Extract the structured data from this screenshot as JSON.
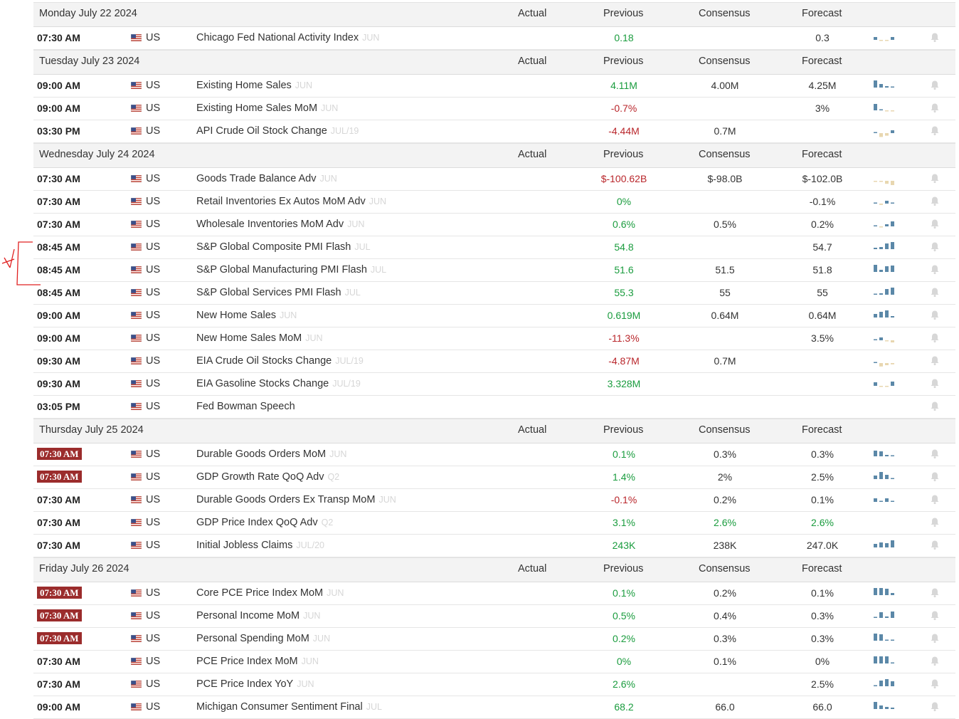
{
  "colors": {
    "positive": "#1a9c3e",
    "negative": "#b9262b",
    "neutral": "#333333",
    "time_badge": "#9b2c2c",
    "spark_blue": "#5b88a8",
    "spark_tan": "#e8d7b0"
  },
  "icons": {
    "flag": "us-flag-icon",
    "alert": "bell-icon",
    "trend": "sparkline-chart"
  },
  "columns": {
    "actual": "Actual",
    "previous": "Previous",
    "consensus": "Consensus",
    "forecast": "Forecast"
  },
  "days": [
    {
      "date": "Monday July 22 2024",
      "events": [
        {
          "time": "07:30 AM",
          "highlight": false,
          "country": "US",
          "name": "Chicago Fed National Activity Index",
          "ref": "JUN",
          "previous": "0.18",
          "prev_color": "green",
          "consensus": "",
          "cons_color": "plain",
          "forecast": "0.3",
          "fore_color": "plain",
          "spark": [
            [
              "b",
              0.4
            ],
            [
              "t",
              -0.2
            ],
            [
              "t",
              -0.2
            ],
            [
              "b",
              0.4
            ]
          ]
        }
      ]
    },
    {
      "date": "Tuesday July 23 2024",
      "events": [
        {
          "time": "09:00 AM",
          "highlight": false,
          "country": "US",
          "name": "Existing Home Sales",
          "ref": "JUN",
          "previous": "4.11M",
          "prev_color": "green",
          "consensus": "4.00M",
          "cons_color": "plain",
          "forecast": "4.25M",
          "fore_color": "plain",
          "spark": [
            [
              "b",
              1
            ],
            [
              "b",
              0.5
            ],
            [
              "b",
              0.2
            ],
            [
              "b",
              0.1
            ]
          ]
        },
        {
          "time": "09:00 AM",
          "highlight": false,
          "country": "US",
          "name": "Existing Home Sales MoM",
          "ref": "JUN",
          "previous": "-0.7%",
          "prev_color": "red",
          "consensus": "",
          "cons_color": "plain",
          "forecast": "3%",
          "fore_color": "plain",
          "spark": [
            [
              "b",
              0.9
            ],
            [
              "b",
              0.1
            ],
            [
              "t",
              -0.1
            ],
            [
              "t",
              -0.1
            ]
          ]
        },
        {
          "time": "03:30 PM",
          "highlight": false,
          "country": "US",
          "name": "API Crude Oil Stock Change",
          "ref": "JUL/19",
          "previous": "-4.44M",
          "prev_color": "red",
          "consensus": "0.7M",
          "cons_color": "plain",
          "forecast": "",
          "fore_color": "plain",
          "spark": [
            [
              "b",
              0.1
            ],
            [
              "t",
              -0.9
            ],
            [
              "t",
              -0.6
            ],
            [
              "b",
              0.4
            ]
          ]
        }
      ]
    },
    {
      "date": "Wednesday July 24 2024",
      "events": [
        {
          "time": "07:30 AM",
          "highlight": false,
          "country": "US",
          "name": "Goods Trade Balance Adv",
          "ref": "JUN",
          "previous": "$-100.62B",
          "prev_color": "red",
          "consensus": "$-98.0B",
          "cons_color": "plain",
          "forecast": "$-102.0B",
          "fore_color": "plain",
          "spark": [
            [
              "t",
              -0.1
            ],
            [
              "t",
              -0.2
            ],
            [
              "t",
              -0.7
            ],
            [
              "t",
              -1
            ]
          ]
        },
        {
          "time": "07:30 AM",
          "highlight": false,
          "country": "US",
          "name": "Retail Inventories Ex Autos MoM Adv",
          "ref": "JUN",
          "previous": "0%",
          "prev_color": "green",
          "consensus": "",
          "cons_color": "plain",
          "forecast": "-0.1%",
          "fore_color": "plain",
          "spark": [
            [
              "b",
              0.1
            ],
            [
              "t",
              -0.3
            ],
            [
              "b",
              0.4
            ],
            [
              "b",
              0
            ]
          ]
        },
        {
          "time": "07:30 AM",
          "highlight": false,
          "country": "US",
          "name": "Wholesale Inventories MoM Adv",
          "ref": "JUN",
          "previous": "0.6%",
          "prev_color": "green",
          "consensus": "0.5%",
          "cons_color": "plain",
          "forecast": "0.2%",
          "fore_color": "plain",
          "spark": [
            [
              "b",
              0.1
            ],
            [
              "t",
              -0.1
            ],
            [
              "b",
              0.3
            ],
            [
              "b",
              0.7
            ]
          ]
        },
        {
          "time": "08:45 AM",
          "highlight": false,
          "country": "US",
          "name": "S&P Global Composite PMI Flash",
          "ref": "JUL",
          "previous": "54.8",
          "prev_color": "green",
          "consensus": "",
          "cons_color": "plain",
          "forecast": "54.7",
          "fore_color": "plain",
          "spark": [
            [
              "b",
              0.2
            ],
            [
              "b",
              0.3
            ],
            [
              "b",
              0.8
            ],
            [
              "b",
              1
            ]
          ]
        },
        {
          "time": "08:45 AM",
          "highlight": false,
          "country": "US",
          "name": "S&P Global Manufacturing PMI Flash",
          "ref": "JUL",
          "previous": "51.6",
          "prev_color": "green",
          "consensus": "51.5",
          "cons_color": "plain",
          "forecast": "51.8",
          "fore_color": "plain",
          "spark": [
            [
              "b",
              1
            ],
            [
              "b",
              0.3
            ],
            [
              "b",
              0.8
            ],
            [
              "b",
              0.9
            ]
          ]
        },
        {
          "time": "08:45 AM",
          "highlight": false,
          "country": "US",
          "name": "S&P Global Services PMI Flash",
          "ref": "JUL",
          "previous": "55.3",
          "prev_color": "green",
          "consensus": "55",
          "cons_color": "plain",
          "forecast": "55",
          "fore_color": "plain",
          "spark": [
            [
              "b",
              0.1
            ],
            [
              "b",
              0.2
            ],
            [
              "b",
              0.8
            ],
            [
              "b",
              1
            ]
          ]
        },
        {
          "time": "09:00 AM",
          "highlight": false,
          "country": "US",
          "name": "New Home Sales",
          "ref": "JUN",
          "previous": "0.619M",
          "prev_color": "green",
          "consensus": "0.64M",
          "cons_color": "plain",
          "forecast": "0.64M",
          "fore_color": "plain",
          "spark": [
            [
              "b",
              0.5
            ],
            [
              "b",
              0.8
            ],
            [
              "b",
              1
            ],
            [
              "b",
              0.2
            ]
          ]
        },
        {
          "time": "09:00 AM",
          "highlight": false,
          "country": "US",
          "name": "New Home Sales MoM",
          "ref": "JUN",
          "previous": "-11.3%",
          "prev_color": "red",
          "consensus": "",
          "cons_color": "plain",
          "forecast": "3.5%",
          "fore_color": "plain",
          "spark": [
            [
              "b",
              0.1
            ],
            [
              "b",
              0.4
            ],
            [
              "t",
              -0.2
            ],
            [
              "t",
              -0.5
            ]
          ]
        },
        {
          "time": "09:30 AM",
          "highlight": false,
          "country": "US",
          "name": "EIA Crude Oil Stocks Change",
          "ref": "JUL/19",
          "previous": "-4.87M",
          "prev_color": "red",
          "consensus": "0.7M",
          "cons_color": "plain",
          "forecast": "",
          "fore_color": "plain",
          "spark": [
            [
              "b",
              0.1
            ],
            [
              "t",
              -0.8
            ],
            [
              "t",
              -0.5
            ],
            [
              "t",
              -0.3
            ]
          ]
        },
        {
          "time": "09:30 AM",
          "highlight": false,
          "country": "US",
          "name": "EIA Gasoline Stocks Change",
          "ref": "JUL/19",
          "previous": "3.328M",
          "prev_color": "green",
          "consensus": "",
          "cons_color": "plain",
          "forecast": "",
          "fore_color": "plain",
          "spark": [
            [
              "b",
              0.5
            ],
            [
              "t",
              -0.2
            ],
            [
              "t",
              -0.2
            ],
            [
              "b",
              0.6
            ]
          ]
        },
        {
          "time": "03:05 PM",
          "highlight": false,
          "country": "US",
          "name": "Fed Bowman Speech",
          "ref": "",
          "previous": "",
          "prev_color": "plain",
          "consensus": "",
          "cons_color": "plain",
          "forecast": "",
          "fore_color": "plain",
          "spark": []
        }
      ]
    },
    {
      "date": "Thursday July 25 2024",
      "events": [
        {
          "time": "07:30 AM",
          "highlight": true,
          "country": "US",
          "name": "Durable Goods Orders MoM",
          "ref": "JUN",
          "previous": "0.1%",
          "prev_color": "green",
          "consensus": "0.3%",
          "cons_color": "plain",
          "forecast": "0.3%",
          "fore_color": "plain",
          "spark": [
            [
              "b",
              0.8
            ],
            [
              "b",
              0.7
            ],
            [
              "b",
              0.2
            ],
            [
              "b",
              0.1
            ]
          ]
        },
        {
          "time": "07:30 AM",
          "highlight": true,
          "country": "US",
          "name": "GDP Growth Rate QoQ Adv",
          "ref": "Q2",
          "previous": "1.4%",
          "prev_color": "green",
          "consensus": "2%",
          "cons_color": "plain",
          "forecast": "2.5%",
          "fore_color": "plain",
          "spark": [
            [
              "b",
              0.5
            ],
            [
              "b",
              1
            ],
            [
              "b",
              0.6
            ],
            [
              "b",
              0.1
            ]
          ]
        },
        {
          "time": "07:30 AM",
          "highlight": false,
          "country": "US",
          "name": "Durable Goods Orders Ex Transp MoM",
          "ref": "JUN",
          "previous": "-0.1%",
          "prev_color": "red",
          "consensus": "0.2%",
          "cons_color": "plain",
          "forecast": "0.1%",
          "fore_color": "plain",
          "spark": [
            [
              "b",
              0.5
            ],
            [
              "b",
              0
            ],
            [
              "b",
              0.5
            ],
            [
              "b",
              0
            ]
          ]
        },
        {
          "time": "07:30 AM",
          "highlight": false,
          "country": "US",
          "name": "GDP Price Index QoQ Adv",
          "ref": "Q2",
          "previous": "3.1%",
          "prev_color": "green",
          "consensus": "2.6%",
          "cons_color": "green",
          "forecast": "2.6%",
          "fore_color": "green",
          "spark": []
        },
        {
          "time": "07:30 AM",
          "highlight": false,
          "country": "US",
          "name": "Initial Jobless Claims",
          "ref": "JUL/20",
          "previous": "243K",
          "prev_color": "green",
          "consensus": "238K",
          "cons_color": "plain",
          "forecast": "247.0K",
          "fore_color": "plain",
          "spark": [
            [
              "b",
              0.5
            ],
            [
              "b",
              0.7
            ],
            [
              "b",
              0.6
            ],
            [
              "b",
              1
            ]
          ]
        }
      ]
    },
    {
      "date": "Friday July 26 2024",
      "events": [
        {
          "time": "07:30 AM",
          "highlight": true,
          "country": "US",
          "name": "Core PCE Price Index MoM",
          "ref": "JUN",
          "previous": "0.1%",
          "prev_color": "green",
          "consensus": "0.2%",
          "cons_color": "plain",
          "forecast": "0.1%",
          "fore_color": "plain",
          "spark": [
            [
              "b",
              1
            ],
            [
              "b",
              1
            ],
            [
              "b",
              0.9
            ],
            [
              "b",
              0.3
            ]
          ]
        },
        {
          "time": "07:30 AM",
          "highlight": true,
          "country": "US",
          "name": "Personal Income MoM",
          "ref": "JUN",
          "previous": "0.5%",
          "prev_color": "green",
          "consensus": "0.4%",
          "cons_color": "plain",
          "forecast": "0.3%",
          "fore_color": "plain",
          "spark": [
            [
              "b",
              0.1
            ],
            [
              "b",
              0.8
            ],
            [
              "b",
              0.2
            ],
            [
              "b",
              0.9
            ]
          ]
        },
        {
          "time": "07:30 AM",
          "highlight": true,
          "country": "US",
          "name": "Personal Spending MoM",
          "ref": "JUN",
          "previous": "0.2%",
          "prev_color": "green",
          "consensus": "0.3%",
          "cons_color": "plain",
          "forecast": "0.3%",
          "fore_color": "plain",
          "spark": [
            [
              "b",
              1
            ],
            [
              "b",
              0.9
            ],
            [
              "b",
              0.1
            ],
            [
              "b",
              0.1
            ]
          ]
        },
        {
          "time": "07:30 AM",
          "highlight": false,
          "country": "US",
          "name": "PCE Price Index MoM",
          "ref": "JUN",
          "previous": "0%",
          "prev_color": "green",
          "consensus": "0.1%",
          "cons_color": "plain",
          "forecast": "0%",
          "fore_color": "plain",
          "spark": [
            [
              "b",
              1
            ],
            [
              "b",
              1
            ],
            [
              "b",
              1
            ],
            [
              "b",
              0
            ]
          ]
        },
        {
          "time": "07:30 AM",
          "highlight": false,
          "country": "US",
          "name": "PCE Price Index YoY",
          "ref": "JUN",
          "previous": "2.6%",
          "prev_color": "green",
          "consensus": "",
          "cons_color": "plain",
          "forecast": "2.5%",
          "fore_color": "plain",
          "spark": [
            [
              "b",
              0.1
            ],
            [
              "b",
              0.8
            ],
            [
              "b",
              1
            ],
            [
              "b",
              0.7
            ]
          ]
        },
        {
          "time": "09:00 AM",
          "highlight": false,
          "country": "US",
          "name": "Michigan Consumer Sentiment Final",
          "ref": "JUL",
          "previous": "68.2",
          "prev_color": "green",
          "consensus": "66.0",
          "cons_color": "plain",
          "forecast": "66.0",
          "fore_color": "plain",
          "spark": [
            [
              "b",
              1
            ],
            [
              "b",
              0.5
            ],
            [
              "b",
              0.3
            ],
            [
              "b",
              0.2
            ]
          ]
        }
      ]
    }
  ]
}
